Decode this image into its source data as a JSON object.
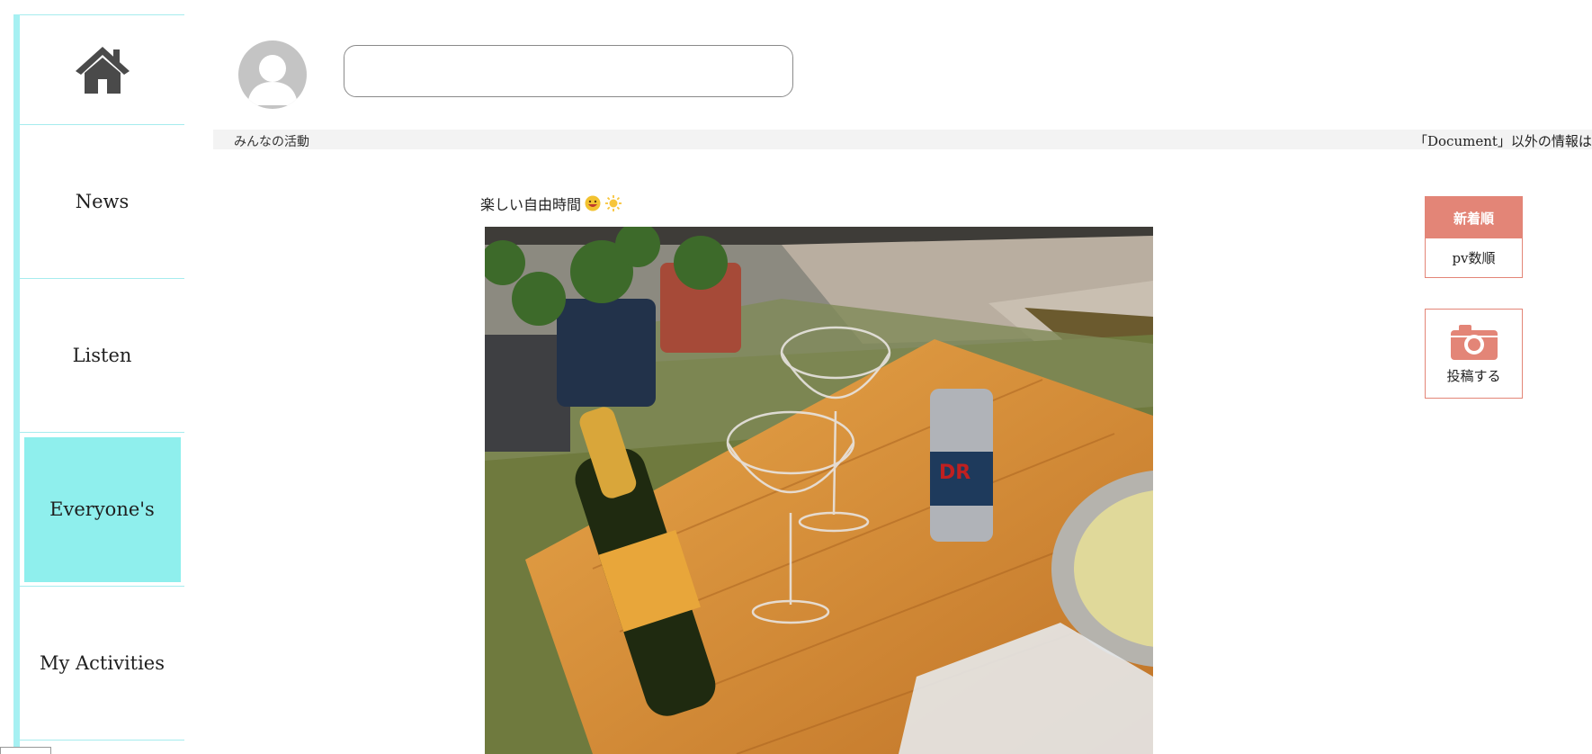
{
  "sidebar": {
    "items": [
      {
        "icon": "home-icon",
        "label": ""
      },
      {
        "label": "News"
      },
      {
        "label": "Listen"
      },
      {
        "label": "Everyone's",
        "active": true
      },
      {
        "label": "My Activities"
      }
    ],
    "accent_color": "#8fefed"
  },
  "header": {
    "search_placeholder": "",
    "search_value": ""
  },
  "bar": {
    "breadcrumb": "みんなの活動",
    "ticker": "「Document」以外の情報は"
  },
  "post": {
    "caption": "楽しい自由時間",
    "emoji": [
      "grinning-face",
      "sun"
    ]
  },
  "sort": {
    "new": "新着順",
    "pv": "pv数順",
    "accent_color": "#e38577"
  },
  "post_button": {
    "label": "投稿する",
    "icon": "camera-icon"
  }
}
